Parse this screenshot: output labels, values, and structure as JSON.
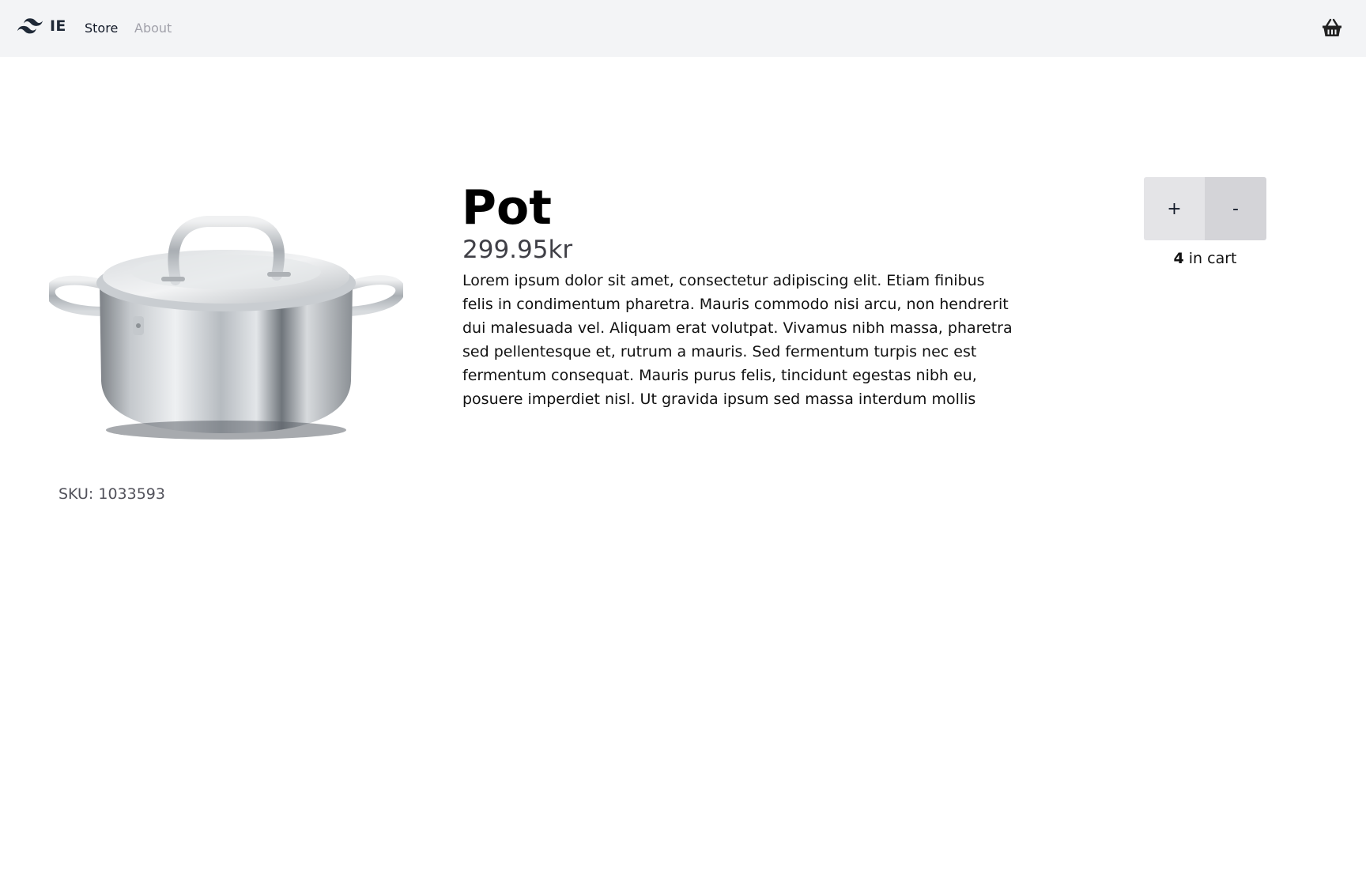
{
  "navbar": {
    "brand_icon": "tailwind-wave-logo-icon",
    "brand_name": "IE",
    "links": [
      {
        "label": "Store",
        "active": true
      },
      {
        "label": "About",
        "active": false
      }
    ],
    "cart_icon": "shopping-basket-icon"
  },
  "product": {
    "image_icon": "stainless-pot-image",
    "title": "Pot",
    "price": "299.95kr",
    "description": "Lorem ipsum dolor sit amet, consectetur adipiscing elit. Etiam finibus felis in condimentum pharetra. Mauris commodo nisi arcu, non hendrerit dui malesuada vel. Aliquam erat volutpat. Vivamus nibh massa, pharetra sed pellentesque et, rutrum a mauris. Sed fermentum turpis nec est fermentum consequat. Mauris purus felis, tincidunt egestas nibh eu, posuere imperdiet nisl. Ut gravida ipsum sed massa interdum mollis",
    "sku": "SKU: 1033593"
  },
  "cart": {
    "plus_label": "+",
    "minus_label": "-",
    "count": "4",
    "in_cart_label": " in cart"
  },
  "colors": {
    "navbar_bg": "#f3f4f6",
    "plus_bg": "#e4e4e7",
    "minus_bg": "#d4d4d8",
    "about_link": "#a1a1aa"
  }
}
